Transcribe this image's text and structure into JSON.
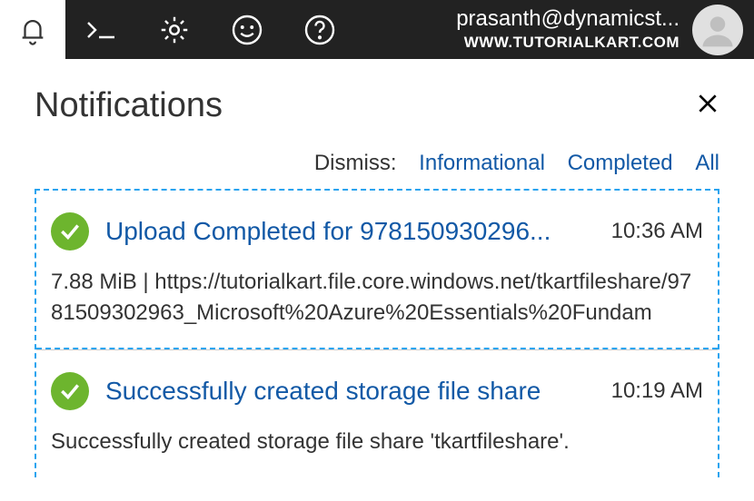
{
  "header": {
    "account_email": "prasanth@dynamicst...",
    "account_sub": "WWW.TUTORIALKART.COM"
  },
  "panel": {
    "title": "Notifications",
    "dismiss_label": "Dismiss:",
    "dismiss_links": {
      "informational": "Informational",
      "completed": "Completed",
      "all": "All"
    }
  },
  "notifications": [
    {
      "status": "success",
      "title": "Upload Completed for 978150930296...",
      "time": "10:36 AM",
      "body": "7.88 MiB | https://tutorialkart.file.core.windows.net/tkartfileshare/9781509302963_Microsoft%20Azure%20Essentials%20Fundam"
    },
    {
      "status": "success",
      "title": "Successfully created storage file share",
      "time": "10:19 AM",
      "body": "Successfully created storage file share 'tkartfileshare'."
    }
  ]
}
